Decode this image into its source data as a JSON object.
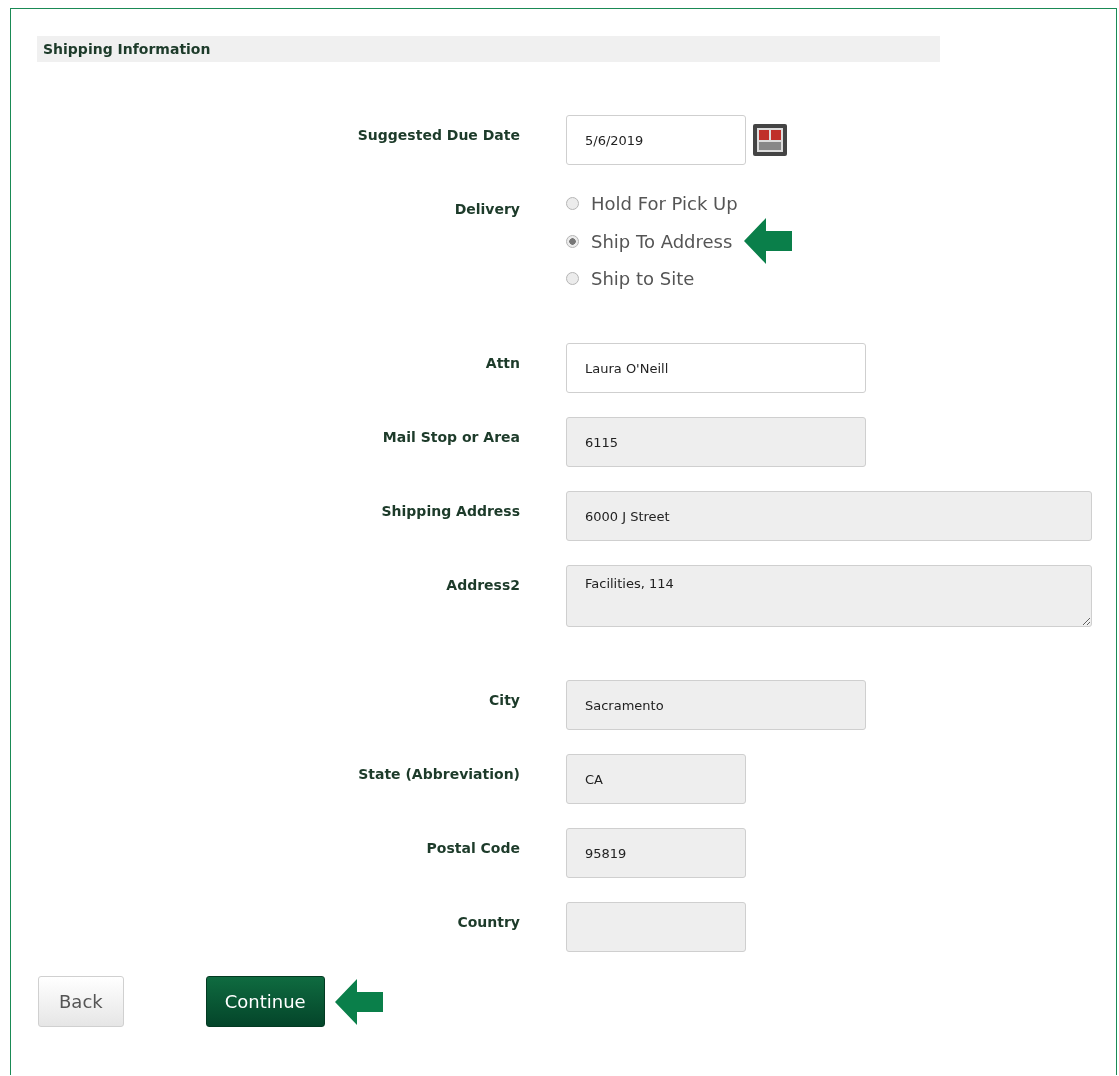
{
  "section": {
    "title": "Shipping Information"
  },
  "fields": [
    {
      "kind": "date",
      "label": "Suggested Due Date",
      "value": "5/6/2019",
      "readonly": false
    },
    {
      "kind": "radio",
      "label": "Delivery",
      "options": [
        {
          "label": "Hold For Pick Up",
          "selected": false,
          "arrow": false
        },
        {
          "label": "Ship To Address",
          "selected": true,
          "arrow": true
        },
        {
          "label": "Ship to Site",
          "selected": false,
          "arrow": false
        }
      ]
    },
    {
      "kind": "medium",
      "label": "Attn",
      "value": "Laura O'Neill",
      "readonly": false
    },
    {
      "kind": "medium",
      "label": "Mail Stop or Area",
      "value": "6115",
      "readonly": true
    },
    {
      "kind": "wide",
      "label": "Shipping Address",
      "value": "6000 J Street",
      "readonly": true
    },
    {
      "kind": "textarea",
      "label": "Address2",
      "value": "Facilities, 114",
      "readonly": true
    },
    {
      "kind": "medium",
      "label": "City",
      "value": "Sacramento",
      "readonly": true
    },
    {
      "kind": "short",
      "label": "State (Abbreviation)",
      "value": "CA",
      "readonly": true
    },
    {
      "kind": "short",
      "label": "Postal Code",
      "value": "95819",
      "readonly": true
    },
    {
      "kind": "short",
      "label": "Country",
      "readonly": true
    }
  ],
  "buttons": [
    {
      "kind": "secondary",
      "label": "Back",
      "arrow": false
    },
    {
      "kind": "primary",
      "label": "Continue",
      "arrow": true
    }
  ]
}
